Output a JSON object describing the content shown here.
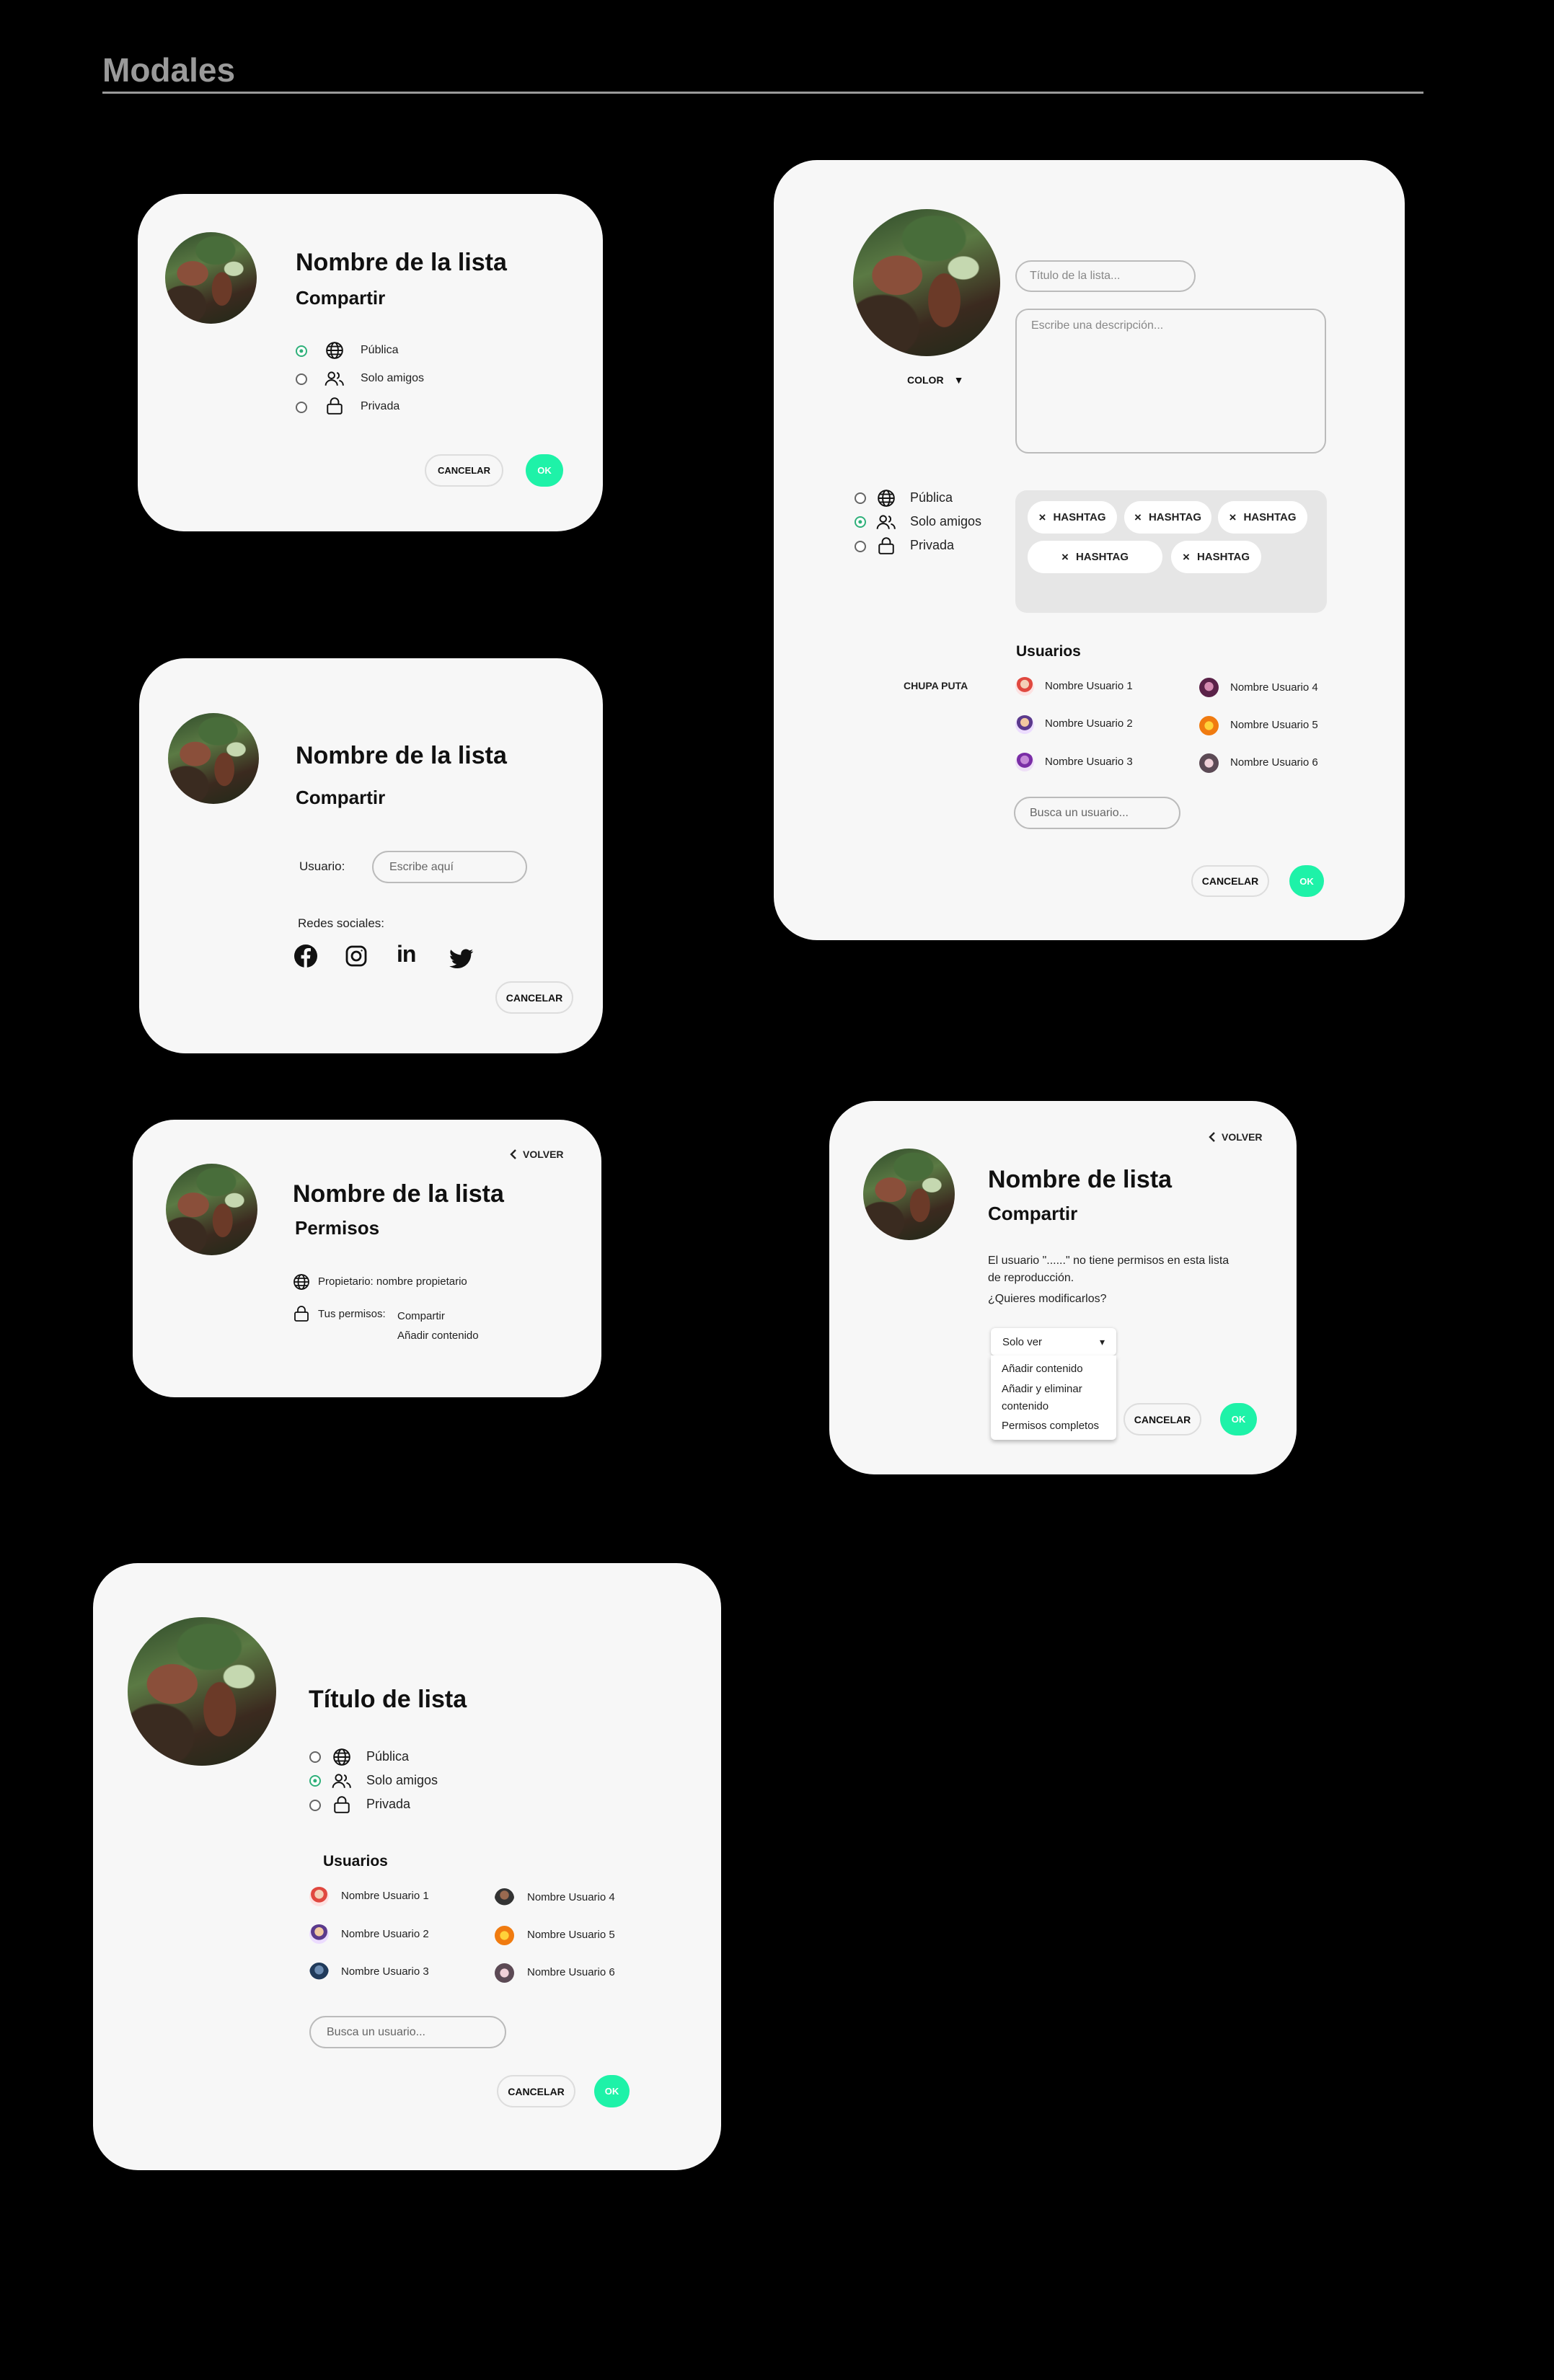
{
  "page": {
    "title": "Modales"
  },
  "modal1": {
    "title": "Nombre de la lista",
    "subtitle": "Compartir",
    "options": [
      "Pública",
      "Solo amigos",
      "Privada"
    ],
    "selected": 0,
    "cancel": "CANCELAR",
    "ok": "OK"
  },
  "modal2": {
    "title": "Nombre de la lista",
    "subtitle": "Compartir",
    "user_label": "Usuario:",
    "user_placeholder": "Escribe aquí",
    "social_label": "Redes sociales:",
    "social": [
      "facebook-icon",
      "instagram-icon",
      "linkedin-icon",
      "twitter-icon"
    ],
    "linkedin_text": "in",
    "cancel": "CANCELAR"
  },
  "modal3": {
    "back": "VOLVER",
    "title": "Nombre de la lista",
    "subtitle": "Permisos",
    "owner": "Propietario: nombre propietario",
    "perms_label": "Tus permisos:",
    "perms": [
      "Compartir",
      "Añadir contenido"
    ]
  },
  "modal4": {
    "title_placeholder": "Título de la lista...",
    "desc_placeholder": "Escribe una descripción...",
    "color_label": "COLOR",
    "color_arrow": "▼",
    "options": [
      "Pública",
      "Solo amigos",
      "Privada"
    ],
    "selected": 1,
    "tags": [
      "HASHTAG",
      "HASHTAG",
      "HASHTAG",
      "HASHTAG",
      "HASHTAG"
    ],
    "tag_remove": "×",
    "users_title": "Usuarios",
    "side_label": "CHUPA PUTA",
    "users": [
      "Nombre Usuario 1",
      "Nombre Usuario 2",
      "Nombre Usuario 3",
      "Nombre Usuario 4",
      "Nombre Usuario 5",
      "Nombre Usuario 6"
    ],
    "search_placeholder": "Busca un usuario...",
    "cancel": "CANCELAR",
    "ok": "OK"
  },
  "modal5": {
    "back": "VOLVER",
    "title": "Nombre de lista",
    "subtitle": "Compartir",
    "message_line1": "El usuario \"......\" no tiene permisos en esta lista",
    "message_line2": "de reproducción.",
    "question": "¿Quieres modificarlos?",
    "select_value": "Solo ver",
    "select_arrow": "▾",
    "dropdown": [
      "Añadir contenido",
      "Añadir y eliminar",
      "contenido",
      "Permisos completos"
    ],
    "cancel": "CANCELAR",
    "ok": "OK"
  },
  "modal6": {
    "title": "Título de lista",
    "options": [
      "Pública",
      "Solo amigos",
      "Privada"
    ],
    "selected": 1,
    "users_title": "Usuarios",
    "users": [
      "Nombre Usuario 1",
      "Nombre Usuario 2",
      "Nombre Usuario 3",
      "Nombre Usuario 4",
      "Nombre Usuario 5",
      "Nombre Usuario 6"
    ],
    "search_placeholder": "Busca un usuario...",
    "cancel": "CANCELAR",
    "ok": "OK"
  },
  "colors": {
    "accent": "#1ef2a8",
    "radio_on": "#2fb07a",
    "background": "#000000",
    "modal": "#f7f7f7"
  }
}
